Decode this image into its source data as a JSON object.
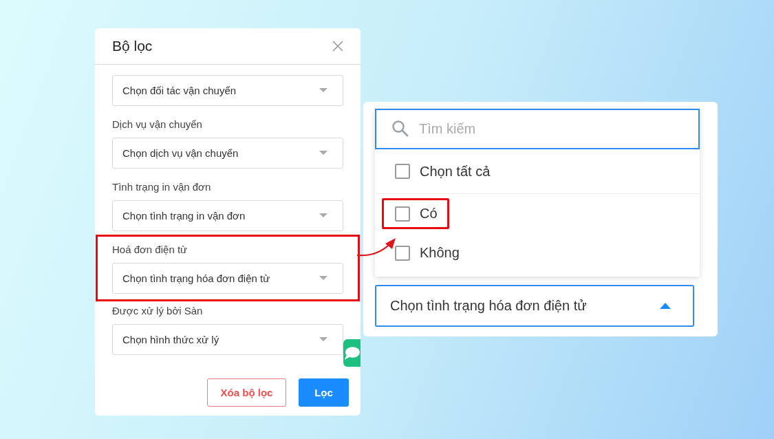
{
  "filter_panel": {
    "title": "Bộ lọc",
    "fields": [
      {
        "placeholder": "Chọn đối tác vận chuyển",
        "highlighted": false
      },
      {
        "label": "Dịch vụ vận chuyển",
        "placeholder": "Chọn dịch vụ vận chuyển",
        "highlighted": false
      },
      {
        "label": "Tình trạng in vận đơn",
        "placeholder": "Chọn tình trạng in vận đơn",
        "highlighted": false
      },
      {
        "label": "Hoá đơn điện tử",
        "placeholder": "Chọn tình trạng hóa đơn điện tử",
        "highlighted": true
      },
      {
        "label": "Được xử lý bởi Sàn",
        "placeholder": "Chọn hình thức xử lý",
        "highlighted": false
      }
    ],
    "buttons": [
      {
        "label": "Xóa bộ lọc",
        "kind": "outline"
      },
      {
        "label": "Lọc",
        "kind": "primary"
      }
    ]
  },
  "dropdown": {
    "search": {
      "placeholder": "Tìm kiếm"
    },
    "options": [
      {
        "label": "Chọn tất cả",
        "checked": false,
        "highlighted": false
      },
      {
        "label": "Có",
        "checked": false,
        "highlighted": true
      },
      {
        "label": "Không",
        "checked": false,
        "highlighted": false
      }
    ],
    "select": {
      "placeholder": "Chọn tình trạng hóa đơn điện tử",
      "expanded": true
    }
  }
}
